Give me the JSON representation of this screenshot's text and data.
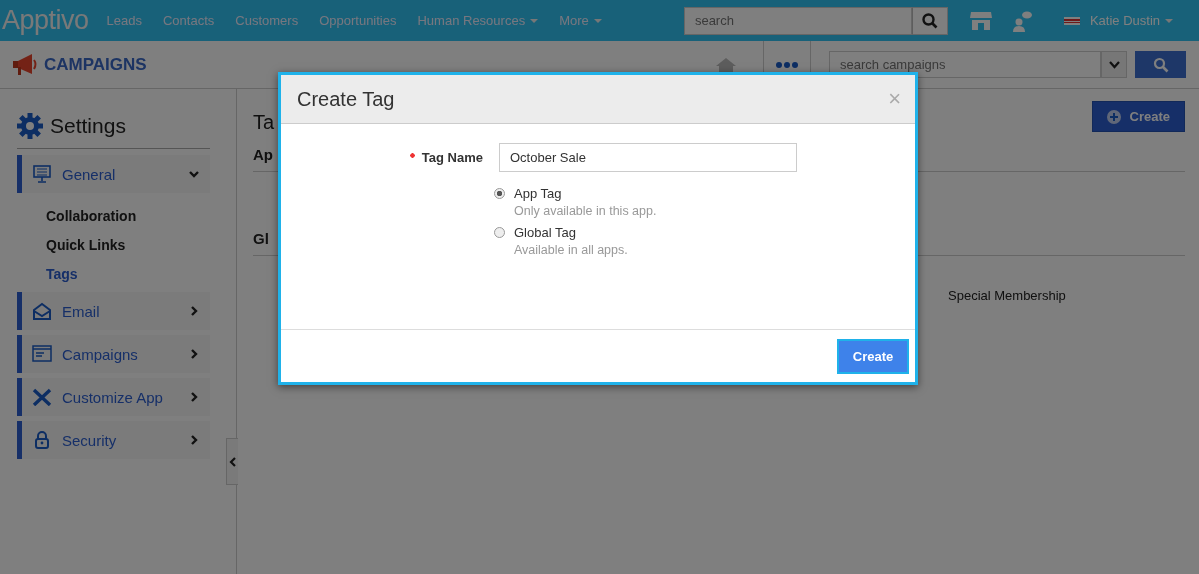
{
  "top_nav": {
    "logo": "Apptivo",
    "items": [
      {
        "label": "Leads",
        "dropdown": false
      },
      {
        "label": "Contacts",
        "dropdown": false
      },
      {
        "label": "Customers",
        "dropdown": false
      },
      {
        "label": "Opportunities",
        "dropdown": false
      },
      {
        "label": "Human Resources",
        "dropdown": true
      },
      {
        "label": "More",
        "dropdown": true
      }
    ],
    "search": {
      "placeholder": "search"
    },
    "user": {
      "name": "Katie Dustin"
    }
  },
  "app_header": {
    "title": "CAMPAIGNS",
    "search": {
      "placeholder": "search campaigns"
    }
  },
  "sidebar": {
    "title": "Settings",
    "sections": [
      {
        "label": "General",
        "expanded": true,
        "children": [
          {
            "label": "Collaboration",
            "selected": false
          },
          {
            "label": "Quick Links",
            "selected": false
          },
          {
            "label": "Tags",
            "selected": true
          }
        ]
      },
      {
        "label": "Email",
        "expanded": false
      },
      {
        "label": "Campaigns",
        "expanded": false
      },
      {
        "label": "Customize App",
        "expanded": false
      },
      {
        "label": "Security",
        "expanded": false
      }
    ]
  },
  "content": {
    "title": "Ta",
    "create_button": "Create",
    "sections": [
      {
        "heading": "Ap"
      },
      {
        "heading": "Gl"
      }
    ],
    "tags": [
      "Special Membership"
    ]
  },
  "modal": {
    "title": "Create Tag",
    "close": "×",
    "field": {
      "label": "Tag Name",
      "required": true,
      "value": "October Sale"
    },
    "options": [
      {
        "label": "App Tag",
        "description": "Only available in this app.",
        "selected": true
      },
      {
        "label": "Global Tag",
        "description": "Available in all apps.",
        "selected": false
      }
    ],
    "button": "Create"
  }
}
